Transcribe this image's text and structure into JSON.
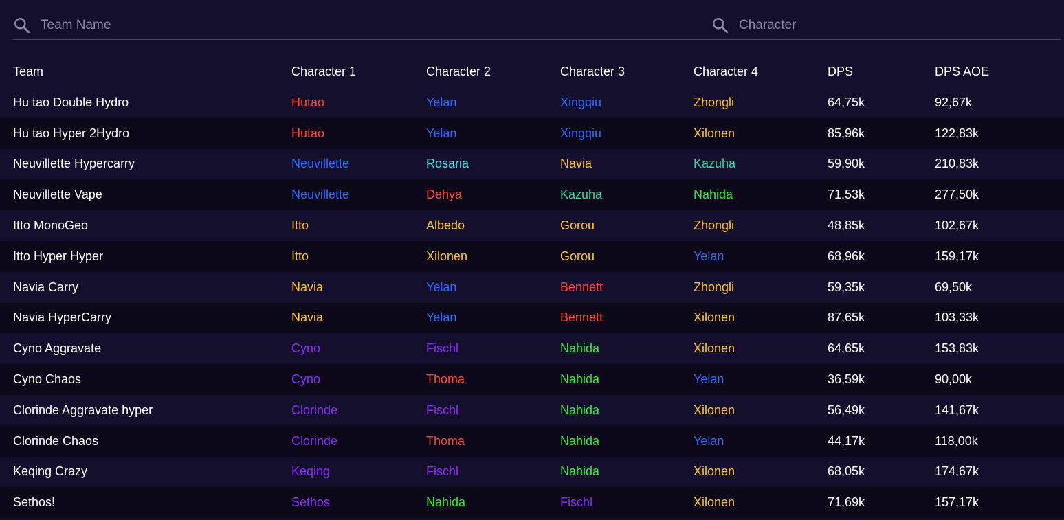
{
  "search": {
    "team_placeholder": "Team Name",
    "character_placeholder": "Character"
  },
  "colors": {
    "background": "#150f2e",
    "row_alt": "#0c0819",
    "pyro": "#ff4a36",
    "hydro": "#2f6bff",
    "geo": "#ffc431",
    "cryo": "#4fe3f0",
    "anemo": "#2fe0a0",
    "dendro": "#2ef03c",
    "electro": "#8a2fff"
  },
  "table": {
    "headers": [
      "Team",
      "Character 1",
      "Character 2",
      "Character 3",
      "Character 4",
      "DPS",
      "DPS AOE"
    ],
    "rows": [
      {
        "team": "Hu tao Double Hydro",
        "chars": [
          [
            "Hutao",
            "pyro"
          ],
          [
            "Yelan",
            "hydro"
          ],
          [
            "Xingqiu",
            "hydro"
          ],
          [
            "Zhongli",
            "geo"
          ]
        ],
        "dps": "64,75k",
        "dps_aoe": "92,67k"
      },
      {
        "team": "Hu tao Hyper 2Hydro",
        "chars": [
          [
            "Hutao",
            "pyro"
          ],
          [
            "Yelan",
            "hydro"
          ],
          [
            "Xingqiu",
            "hydro"
          ],
          [
            "Xilonen",
            "geo"
          ]
        ],
        "dps": "85,96k",
        "dps_aoe": "122,83k"
      },
      {
        "team": "Neuvillette Hypercarry",
        "chars": [
          [
            "Neuvillette",
            "hydro"
          ],
          [
            "Rosaria",
            "cryo"
          ],
          [
            "Navia",
            "geo"
          ],
          [
            "Kazuha",
            "anemo"
          ]
        ],
        "dps": "59,90k",
        "dps_aoe": "210,83k"
      },
      {
        "team": "Neuvillette Vape",
        "chars": [
          [
            "Neuvillette",
            "hydro"
          ],
          [
            "Dehya",
            "pyro"
          ],
          [
            "Kazuha",
            "anemo"
          ],
          [
            "Nahida",
            "dendro"
          ]
        ],
        "dps": "71,53k",
        "dps_aoe": "277,50k"
      },
      {
        "team": "Itto MonoGeo",
        "chars": [
          [
            "Itto",
            "geo"
          ],
          [
            "Albedo",
            "geo"
          ],
          [
            "Gorou",
            "geo"
          ],
          [
            "Zhongli",
            "geo"
          ]
        ],
        "dps": "48,85k",
        "dps_aoe": "102,67k"
      },
      {
        "team": "Itto Hyper Hyper",
        "chars": [
          [
            "Itto",
            "geo"
          ],
          [
            "Xilonen",
            "geo"
          ],
          [
            "Gorou",
            "geo"
          ],
          [
            "Yelan",
            "hydro"
          ]
        ],
        "dps": "68,96k",
        "dps_aoe": "159,17k"
      },
      {
        "team": "Navia Carry",
        "chars": [
          [
            "Navia",
            "geo"
          ],
          [
            "Yelan",
            "hydro"
          ],
          [
            "Bennett",
            "pyro"
          ],
          [
            "Zhongli",
            "geo"
          ]
        ],
        "dps": "59,35k",
        "dps_aoe": "69,50k"
      },
      {
        "team": "Navia HyperCarry",
        "chars": [
          [
            "Navia",
            "geo"
          ],
          [
            "Yelan",
            "hydro"
          ],
          [
            "Bennett",
            "pyro"
          ],
          [
            "Xilonen",
            "geo"
          ]
        ],
        "dps": "87,65k",
        "dps_aoe": "103,33k"
      },
      {
        "team": "Cyno Aggravate",
        "chars": [
          [
            "Cyno",
            "electro"
          ],
          [
            "Fischl",
            "electro"
          ],
          [
            "Nahida",
            "dendro"
          ],
          [
            "Xilonen",
            "geo"
          ]
        ],
        "dps": "64,65k",
        "dps_aoe": "153,83k"
      },
      {
        "team": "Cyno Chaos",
        "chars": [
          [
            "Cyno",
            "electro"
          ],
          [
            "Thoma",
            "pyro"
          ],
          [
            "Nahida",
            "dendro"
          ],
          [
            "Yelan",
            "hydro"
          ]
        ],
        "dps": "36,59k",
        "dps_aoe": "90,00k"
      },
      {
        "team": "Clorinde Aggravate hyper",
        "chars": [
          [
            "Clorinde",
            "electro"
          ],
          [
            "Fischl",
            "electro"
          ],
          [
            "Nahida",
            "dendro"
          ],
          [
            "Xilonen",
            "geo"
          ]
        ],
        "dps": "56,49k",
        "dps_aoe": "141,67k"
      },
      {
        "team": "Clorinde Chaos",
        "chars": [
          [
            "Clorinde",
            "electro"
          ],
          [
            "Thoma",
            "pyro"
          ],
          [
            "Nahida",
            "dendro"
          ],
          [
            "Yelan",
            "hydro"
          ]
        ],
        "dps": "44,17k",
        "dps_aoe": "118,00k"
      },
      {
        "team": "Keqing Crazy",
        "chars": [
          [
            "Keqing",
            "electro"
          ],
          [
            "Fischl",
            "electro"
          ],
          [
            "Nahida",
            "dendro"
          ],
          [
            "Xilonen",
            "geo"
          ]
        ],
        "dps": "68,05k",
        "dps_aoe": "174,67k"
      },
      {
        "team": "Sethos!",
        "chars": [
          [
            "Sethos",
            "electro"
          ],
          [
            "Nahida",
            "dendro"
          ],
          [
            "Fischl",
            "electro"
          ],
          [
            "Xilonen",
            "geo"
          ]
        ],
        "dps": "71,69k",
        "dps_aoe": "157,17k"
      }
    ]
  }
}
